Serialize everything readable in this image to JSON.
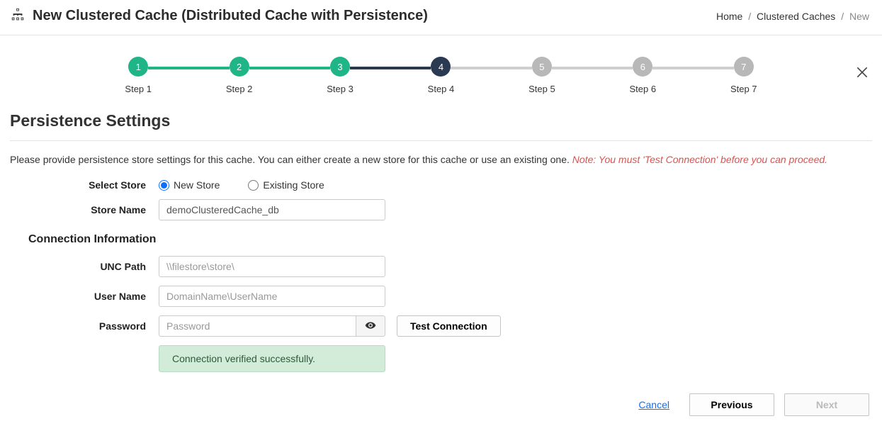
{
  "header": {
    "title": "New Clustered Cache (Distributed Cache with Persistence)",
    "breadcrumb": {
      "home": "Home",
      "caches": "Clustered Caches",
      "current": "New"
    }
  },
  "stepper": {
    "steps": [
      {
        "num": "1",
        "label": "Step 1"
      },
      {
        "num": "2",
        "label": "Step 2"
      },
      {
        "num": "3",
        "label": "Step 3"
      },
      {
        "num": "4",
        "label": "Step 4"
      },
      {
        "num": "5",
        "label": "Step 5"
      },
      {
        "num": "6",
        "label": "Step 6"
      },
      {
        "num": "7",
        "label": "Step 7"
      }
    ]
  },
  "section": {
    "title": "Persistence Settings"
  },
  "instruction": {
    "text": "Please provide persistence store settings for this cache. You can either create a new store for this cache or use an existing one. ",
    "note": "Note: You must 'Test Connection' before you can proceed."
  },
  "form": {
    "selectStoreLabel": "Select Store",
    "newStoreLabel": "New Store",
    "existingStoreLabel": "Existing Store",
    "storeNameLabel": "Store Name",
    "storeNameValue": "demoClusteredCache_db",
    "connectionInfoTitle": "Connection Information",
    "uncPathLabel": "UNC Path",
    "uncPathPlaceholder": "\\\\filestore\\store\\",
    "userNameLabel": "User Name",
    "userNamePlaceholder": "DomainName\\UserName",
    "passwordLabel": "Password",
    "passwordPlaceholder": "Password",
    "testConnectionLabel": "Test Connection",
    "successMessage": "Connection verified successfully."
  },
  "footer": {
    "cancel": "Cancel",
    "previous": "Previous",
    "next": "Next"
  }
}
